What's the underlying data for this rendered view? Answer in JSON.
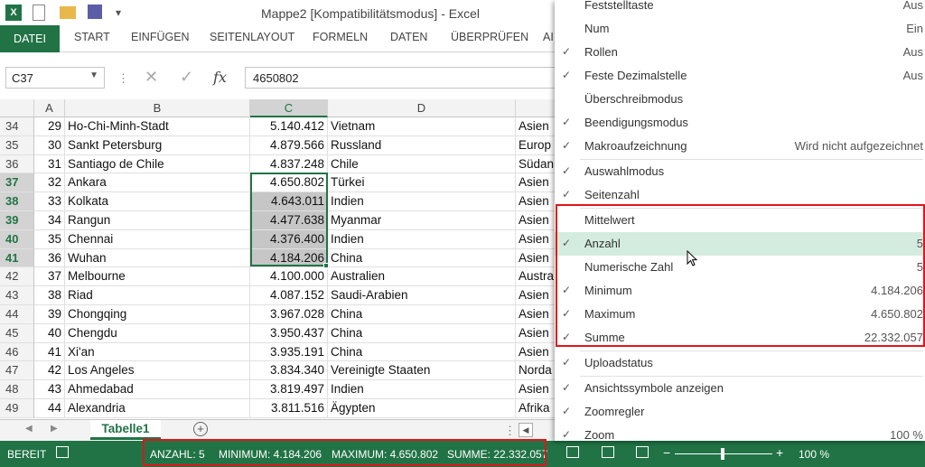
{
  "window": {
    "title": "Mappe2  [Kompatibilitätsmodus] - Excel"
  },
  "ribbon": {
    "tabs": [
      "DATEI",
      "START",
      "EINFÜGEN",
      "SEITENLAYOUT",
      "FORMELN",
      "DATEN",
      "ÜBERPRÜFEN",
      "AI"
    ]
  },
  "formula_bar": {
    "name_box": "C37",
    "fx": "fx",
    "value": "4650802"
  },
  "columns": [
    "A",
    "B",
    "C",
    "D"
  ],
  "rows": [
    {
      "r": "34",
      "a": "29",
      "b": "Ho-Chi-Minh-Stadt",
      "c": "5.140.412",
      "d": "Vietnam",
      "e": "Asien"
    },
    {
      "r": "35",
      "a": "30",
      "b": "Sankt Petersburg",
      "c": "4.879.566",
      "d": "Russland",
      "e": "Europ"
    },
    {
      "r": "36",
      "a": "31",
      "b": "Santiago de Chile",
      "c": "4.837.248",
      "d": "Chile",
      "e": "Südan"
    },
    {
      "r": "37",
      "a": "32",
      "b": "Ankara",
      "c": "4.650.802",
      "d": "Türkei",
      "e": "Asien"
    },
    {
      "r": "38",
      "a": "33",
      "b": "Kolkata",
      "c": "4.643.011",
      "d": "Indien",
      "e": "Asien"
    },
    {
      "r": "39",
      "a": "34",
      "b": "Rangun",
      "c": "4.477.638",
      "d": "Myanmar",
      "e": "Asien"
    },
    {
      "r": "40",
      "a": "35",
      "b": "Chennai",
      "c": "4.376.400",
      "d": "Indien",
      "e": "Asien"
    },
    {
      "r": "41",
      "a": "36",
      "b": "Wuhan",
      "c": "4.184.206",
      "d": "China",
      "e": "Asien"
    },
    {
      "r": "42",
      "a": "37",
      "b": "Melbourne",
      "c": "4.100.000",
      "d": "Australien",
      "e": "Austra"
    },
    {
      "r": "43",
      "a": "38",
      "b": "Riad",
      "c": "4.087.152",
      "d": "Saudi-Arabien",
      "e": "Asien"
    },
    {
      "r": "44",
      "a": "39",
      "b": "Chongqing",
      "c": "3.967.028",
      "d": "China",
      "e": "Asien"
    },
    {
      "r": "45",
      "a": "40",
      "b": "Chengdu",
      "c": "3.950.437",
      "d": "China",
      "e": "Asien"
    },
    {
      "r": "46",
      "a": "41",
      "b": "Xi'an",
      "c": "3.935.191",
      "d": "China",
      "e": "Asien"
    },
    {
      "r": "47",
      "a": "42",
      "b": "Los Angeles",
      "c": "3.834.340",
      "d": "Vereinigte Staaten",
      "e": "Norda"
    },
    {
      "r": "48",
      "a": "43",
      "b": "Ahmedabad",
      "c": "3.819.497",
      "d": "Indien",
      "e": "Asien"
    },
    {
      "r": "49",
      "a": "44",
      "b": "Alexandria",
      "c": "3.811.516",
      "d": "Ägypten",
      "e": "Afrika"
    }
  ],
  "sheet": {
    "tab": "Tabelle1"
  },
  "status": {
    "ready": "BEREIT",
    "count": "ANZAHL: 5",
    "min": "MINIMUM: 4.184.206",
    "max": "MAXIMUM: 4.650.802",
    "sum": "SUMME: 22.332.057",
    "zoom": "100 %"
  },
  "menu": [
    {
      "label": "Feststelltaste",
      "value": "Aus",
      "checked": false
    },
    {
      "label": "Num",
      "value": "Ein",
      "checked": false
    },
    {
      "label": "Rollen",
      "value": "Aus",
      "checked": true
    },
    {
      "label": "Feste Dezimalstelle",
      "value": "Aus",
      "checked": true
    },
    {
      "label": "Überschreibmodus",
      "value": "",
      "checked": false
    },
    {
      "label": "Beendigungsmodus",
      "value": "",
      "checked": true
    },
    {
      "label": "Makroaufzeichnung",
      "value": "Wird nicht aufgezeichnet",
      "checked": true
    },
    {
      "label": "Auswahlmodus",
      "value": "",
      "checked": true
    },
    {
      "label": "Seitenzahl",
      "value": "",
      "checked": true
    },
    {
      "label": "Mittelwert",
      "value": "",
      "checked": false
    },
    {
      "label": "Anzahl",
      "value": "5",
      "checked": true
    },
    {
      "label": "Numerische Zahl",
      "value": "5",
      "checked": false
    },
    {
      "label": "Minimum",
      "value": "4.184.206",
      "checked": true
    },
    {
      "label": "Maximum",
      "value": "4.650.802",
      "checked": true
    },
    {
      "label": "Summe",
      "value": "22.332.057",
      "checked": true
    },
    {
      "label": "Uploadstatus",
      "value": "",
      "checked": true
    },
    {
      "label": "Ansichtssymbole anzeigen",
      "value": "",
      "checked": true
    },
    {
      "label": "Zoomregler",
      "value": "",
      "checked": true
    },
    {
      "label": "Zoom",
      "value": "100 %",
      "checked": true
    }
  ]
}
